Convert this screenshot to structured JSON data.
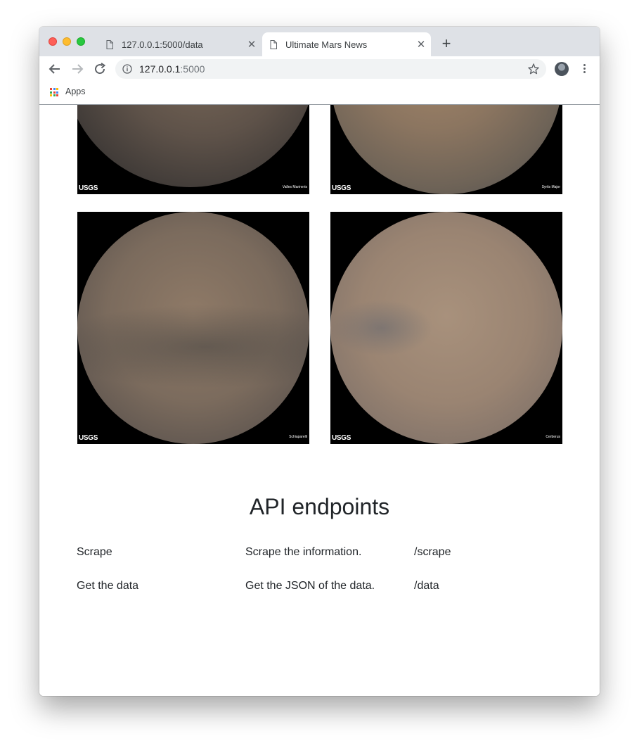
{
  "browser": {
    "tabs": [
      {
        "title": "127.0.0.1:5000/data",
        "active": false
      },
      {
        "title": "Ultimate Mars News",
        "active": true
      }
    ],
    "url_host": "127.0.0.1",
    "url_port": ":5000",
    "bookmarks_apps": "Apps"
  },
  "hemispheres": [
    {
      "name": "Valles Marineris",
      "logo": "USGS"
    },
    {
      "name": "Syrtis Major",
      "logo": "USGS"
    },
    {
      "name": "Schiaparelli",
      "logo": "USGS"
    },
    {
      "name": "Cerberus",
      "logo": "USGS"
    }
  ],
  "api": {
    "title": "API endpoints",
    "rows": [
      {
        "name": "Scrape",
        "description": "Scrape the information.",
        "route": "/scrape"
      },
      {
        "name": "Get the data",
        "description": "Get the JSON of the data.",
        "route": "/data"
      }
    ]
  },
  "colors": {
    "tabstrip": "#dee1e6",
    "omnibox": "#f1f3f4",
    "text": "#212529"
  }
}
